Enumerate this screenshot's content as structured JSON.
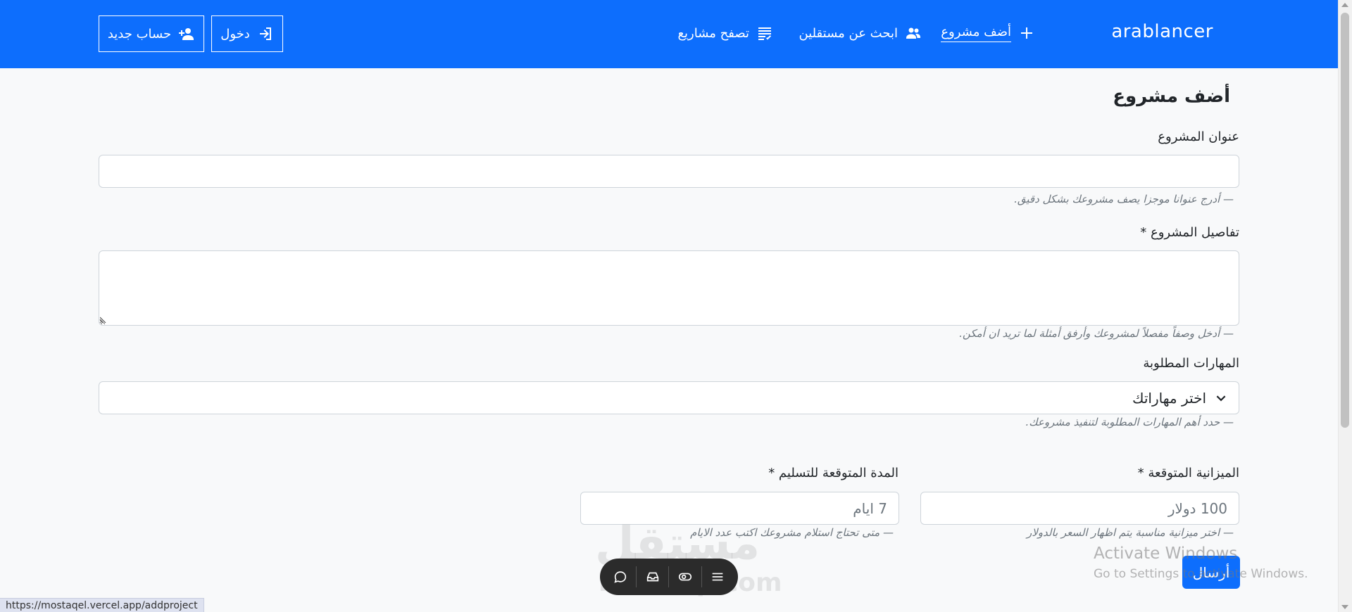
{
  "nav": {
    "brand": "arablancer",
    "add_project": "أضف مشروع",
    "find_freelancers": "ابحث عن مستقلين",
    "browse_projects": "تصفح مشاريع",
    "login": "دخول",
    "signup": "حساب جديد"
  },
  "form": {
    "title": "أضف مشروع",
    "project_title_label": "عنوان المشروع",
    "project_title_value": "",
    "project_title_help": "—  أدرج عنوانا موجزا يصف مشروعك بشكل دقيق.",
    "details_label": "تفاصيل المشروع *",
    "details_value": "",
    "details_help": "—  أدخل وصفاً مفصلاً لمشروعك وأرفق أمثلة لما تريد ان أمكن.",
    "skills_label": "المهارات المطلوبة",
    "skills_select": "اختر مهاراتك",
    "skills_help": "—  حدد أهم المهارات المطلوبة لتنفيذ مشروعك.",
    "budget_label": "الميزانية المتوقعة *",
    "budget_placeholder": "100 دولار",
    "budget_help": "—  اختر ميزانية مناسبة يتم اظهار السعر بالدولار",
    "duration_label": "المدة المتوقعة للتسليم *",
    "duration_placeholder": "7 ايام",
    "duration_help": "—  متى تحتاج استلام مشروعك اكتب عدد الايام",
    "submit": "أرسال"
  },
  "overlay": {
    "activate_title": "Activate Windows",
    "activate_sub": "Go to Settings to activate Windows.",
    "watermark_ar": "مستقل",
    "watermark_en": "mostaql.com",
    "status_url": "https://mostaqel.vercel.app/addproject"
  },
  "icons": {
    "add_project": "plus-icon",
    "find_freelancers": "people-icon",
    "browse_projects": "list-check-icon",
    "login": "login-arrow-icon",
    "signup": "person-add-icon"
  },
  "colors": {
    "primary": "#0d6efd",
    "background": "#f8f9fa"
  }
}
